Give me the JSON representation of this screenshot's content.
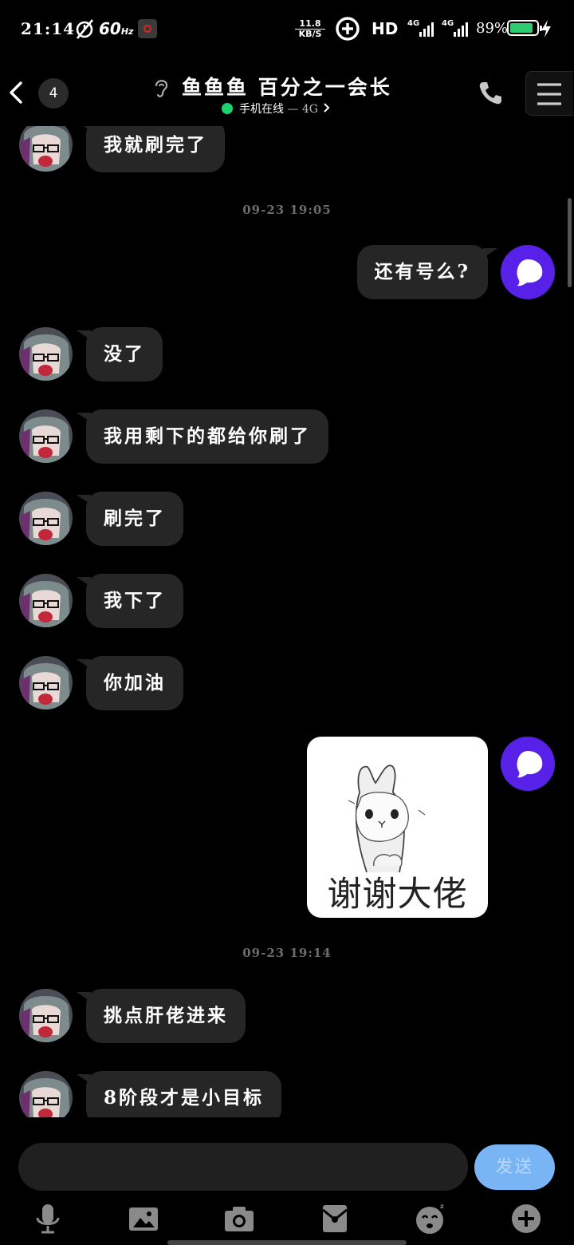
{
  "status_bar": {
    "time": "21:14",
    "refresh_rate": "60",
    "refresh_unit": "Hz",
    "net_speed_value": "11.8",
    "net_speed_unit": "KB/S",
    "hd_label": "HD",
    "signal_1": "4G",
    "signal_2": "4G",
    "battery_percent": "89%",
    "battery_level": 0.89,
    "battery_color": "#2ecc71"
  },
  "header": {
    "unread_count": "4",
    "title": "鱼鱼鱼 百分之一会长",
    "status_text": "手机在线",
    "network_text": " — 4G",
    "online_color": "#1fd16e"
  },
  "messages": [
    {
      "side": "left",
      "text": "我就刷完了"
    },
    {
      "type": "timestamp",
      "text": "09-23 19:05"
    },
    {
      "side": "right",
      "text": "还有号么?"
    },
    {
      "side": "left",
      "text": "没了"
    },
    {
      "side": "left",
      "text": "我用剩下的都给你刷了"
    },
    {
      "side": "left",
      "text": "刷完了"
    },
    {
      "side": "left",
      "text": "我下了"
    },
    {
      "side": "left",
      "text": "你加油"
    },
    {
      "side": "right",
      "type": "sticker",
      "caption": "谢谢大佬"
    },
    {
      "type": "timestamp",
      "text": "09-23 19:14"
    },
    {
      "side": "left",
      "text": "挑点肝佬进来"
    },
    {
      "side": "left",
      "text": "8阶段才是小目标"
    }
  ],
  "input": {
    "placeholder": "",
    "send_label": "发送",
    "send_color": "#79b4f4"
  },
  "toolbar_icons": [
    "microphone-icon",
    "image-icon",
    "camera-icon",
    "red-packet-icon",
    "emoji-icon",
    "plus-icon"
  ],
  "colors": {
    "background": "#000000",
    "bubble": "#262626",
    "my_avatar": "#5721e8"
  }
}
